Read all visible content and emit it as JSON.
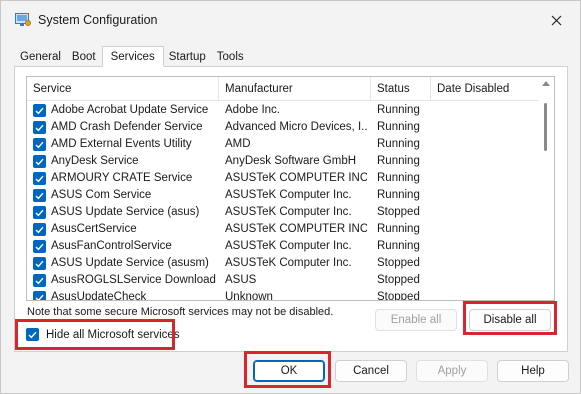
{
  "window": {
    "title": "System Configuration",
    "app_icon": "msconfig-icon",
    "close_glyph": "✕"
  },
  "tabs": [
    {
      "label": "General",
      "active": false
    },
    {
      "label": "Boot",
      "active": false
    },
    {
      "label": "Services",
      "active": true
    },
    {
      "label": "Startup",
      "active": false
    },
    {
      "label": "Tools",
      "active": false
    }
  ],
  "services": {
    "columns": [
      "Service",
      "Manufacturer",
      "Status",
      "Date Disabled"
    ],
    "rows": [
      {
        "name": "Adobe Acrobat Update Service",
        "manufacturer": "Adobe Inc.",
        "status": "Running",
        "date_disabled": "",
        "checked": true
      },
      {
        "name": "AMD Crash Defender Service",
        "manufacturer": "Advanced Micro Devices, I...",
        "status": "Running",
        "date_disabled": "",
        "checked": true
      },
      {
        "name": "AMD External Events Utility",
        "manufacturer": "AMD",
        "status": "Running",
        "date_disabled": "",
        "checked": true
      },
      {
        "name": "AnyDesk Service",
        "manufacturer": "AnyDesk Software GmbH",
        "status": "Running",
        "date_disabled": "",
        "checked": true
      },
      {
        "name": "ARMOURY CRATE Service",
        "manufacturer": "ASUSTeK COMPUTER INC.",
        "status": "Running",
        "date_disabled": "",
        "checked": true
      },
      {
        "name": "ASUS Com Service",
        "manufacturer": "ASUSTeK Computer Inc.",
        "status": "Running",
        "date_disabled": "",
        "checked": true
      },
      {
        "name": "ASUS Update Service (asus)",
        "manufacturer": "ASUSTeK Computer Inc.",
        "status": "Stopped",
        "date_disabled": "",
        "checked": true
      },
      {
        "name": "AsusCertService",
        "manufacturer": "ASUSTeK COMPUTER INC.",
        "status": "Running",
        "date_disabled": "",
        "checked": true
      },
      {
        "name": "AsusFanControlService",
        "manufacturer": "ASUSTeK Computer Inc.",
        "status": "Running",
        "date_disabled": "",
        "checked": true
      },
      {
        "name": "ASUS Update Service (asusm)",
        "manufacturer": "ASUSTeK Computer Inc.",
        "status": "Stopped",
        "date_disabled": "",
        "checked": true
      },
      {
        "name": "AsusROGLSLService Download R...",
        "manufacturer": "ASUS",
        "status": "Stopped",
        "date_disabled": "",
        "checked": true
      },
      {
        "name": "AsusUpdateCheck",
        "manufacturer": "Unknown",
        "status": "Stopped",
        "date_disabled": "",
        "checked": true
      }
    ]
  },
  "note": "Note that some secure Microsoft services may not be disabled.",
  "buttons": {
    "enable_all": "Enable all",
    "disable_all": "Disable all",
    "ok": "OK",
    "cancel": "Cancel",
    "apply": "Apply",
    "help": "Help"
  },
  "hide_microsoft": {
    "label": "Hide all Microsoft services",
    "checked": true
  },
  "colors": {
    "accent": "#0067c0",
    "highlight": "#d7262e"
  }
}
